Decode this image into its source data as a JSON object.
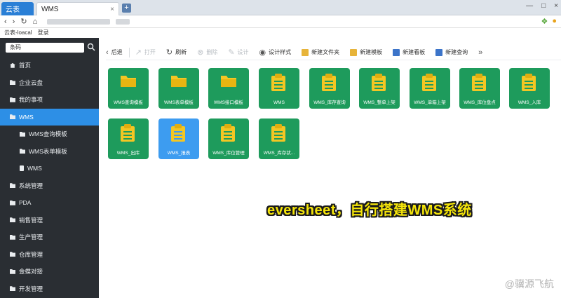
{
  "browser": {
    "tabs": [
      {
        "label": "云表"
      },
      {
        "label": "WMS"
      }
    ],
    "new_tab": "+",
    "close_tab": "×",
    "window_controls": [
      "—",
      "□",
      "×"
    ],
    "bookmarks": [
      "云表-loacal",
      "登录"
    ]
  },
  "sidebar": {
    "search_value": "条码",
    "items": [
      {
        "label": "首页",
        "icon": "home-icon",
        "level": "top"
      },
      {
        "label": "企业云盘",
        "icon": "folder-icon",
        "level": "top"
      },
      {
        "label": "我的事项",
        "icon": "folder-icon",
        "level": "top"
      },
      {
        "label": "WMS",
        "icon": "folder-icon",
        "level": "top",
        "active": true
      },
      {
        "label": "WMS查询模板",
        "icon": "folder-icon",
        "level": "sub"
      },
      {
        "label": "WMS表单模板",
        "icon": "folder-icon",
        "level": "sub"
      },
      {
        "label": "WMS",
        "icon": "doc-icon",
        "level": "sub"
      },
      {
        "label": "系统管理",
        "icon": "folder-icon",
        "level": "top"
      },
      {
        "label": "PDA",
        "icon": "folder-icon",
        "level": "top"
      },
      {
        "label": "销售管理",
        "icon": "folder-icon",
        "level": "top"
      },
      {
        "label": "生产管理",
        "icon": "folder-icon",
        "level": "top"
      },
      {
        "label": "仓库管理",
        "icon": "folder-icon",
        "level": "top"
      },
      {
        "label": "金蝶对接",
        "icon": "folder-icon",
        "level": "top"
      },
      {
        "label": "开发管理",
        "icon": "folder-icon",
        "level": "top"
      }
    ]
  },
  "toolbar": {
    "back": "后退",
    "open": "打开",
    "refresh": "刷新",
    "delete": "删除",
    "design": "设计",
    "design_style": "设计样式",
    "new_folder": "新建文件夹",
    "new_template": "新建模板",
    "new_board": "新建看板",
    "new_query": "新建查询",
    "more": "»"
  },
  "tiles": [
    {
      "label": "WMS查询模板",
      "type": "folder"
    },
    {
      "label": "WMS表单模板",
      "type": "folder"
    },
    {
      "label": "WMS接口模板",
      "type": "folder"
    },
    {
      "label": "WMS",
      "type": "doc"
    },
    {
      "label": "WMS_库存查询",
      "type": "doc"
    },
    {
      "label": "WMS_整单上架",
      "type": "doc"
    },
    {
      "label": "WMS_单箱上架",
      "type": "doc"
    },
    {
      "label": "WMS_库位盘点",
      "type": "doc"
    },
    {
      "label": "WMS_入库",
      "type": "doc"
    },
    {
      "label": "WMS_出库",
      "type": "doc"
    },
    {
      "label": "WMS_报表",
      "type": "doc",
      "selected": true
    },
    {
      "label": "WMS_库位管理",
      "type": "doc"
    },
    {
      "label": "WMS_库存状...",
      "type": "doc"
    }
  ],
  "caption": "eversheet，自行搭建WMS系统",
  "watermark": "@骥源飞航",
  "colors": {
    "sidebar_bg": "#2a2e33",
    "active_blue": "#2d8fe6",
    "tile_green": "#1e9b5c",
    "tile_selected": "#3d9cf0",
    "icon_yellow": "#f3c624",
    "caption_yellow": "#f4e40a"
  }
}
